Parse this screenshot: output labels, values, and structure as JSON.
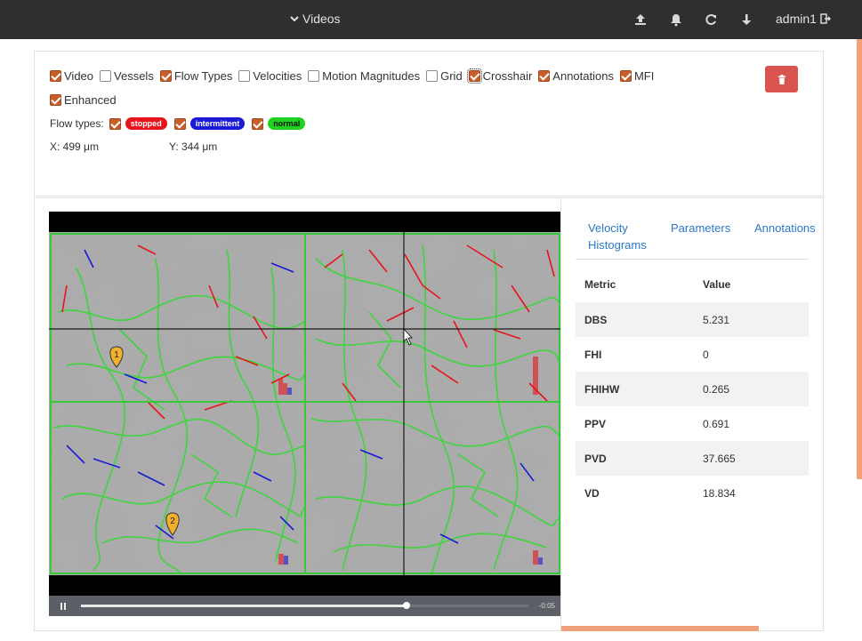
{
  "navbar": {
    "menu_label": "Videos",
    "user": "admin1"
  },
  "filters": {
    "checkboxes": [
      {
        "label": "Video",
        "checked": true
      },
      {
        "label": "Vessels",
        "checked": false
      },
      {
        "label": "Flow Types",
        "checked": true
      },
      {
        "label": "Velocities",
        "checked": false
      },
      {
        "label": "Motion Magnitudes",
        "checked": false
      },
      {
        "label": "Grid",
        "checked": false
      },
      {
        "label": "Crosshair",
        "checked": true
      },
      {
        "label": "Annotations",
        "checked": true
      },
      {
        "label": "MFI",
        "checked": true
      },
      {
        "label": "Enhanced",
        "checked": true
      }
    ],
    "flow_types_label": "Flow types:",
    "flow_types": [
      {
        "label": "stopped",
        "color": "#e8141c",
        "checked": true
      },
      {
        "label": "intermittent",
        "color": "#1a1ad6",
        "checked": true
      },
      {
        "label": "normal",
        "color": "#1fd21f",
        "checked": true
      }
    ],
    "x_coord": "X: 499 μm",
    "y_coord": "Y: 344 μm"
  },
  "video": {
    "time_remaining": "-0:05",
    "progress": 0.727,
    "markers": [
      "1",
      "2"
    ]
  },
  "tabs": [
    {
      "label": "Velocity Histograms"
    },
    {
      "label": "Parameters"
    },
    {
      "label": "Annotations"
    }
  ],
  "metrics": {
    "headers": [
      "Metric",
      "Value"
    ],
    "rows": [
      {
        "metric": "DBS",
        "value": "5.231"
      },
      {
        "metric": "FHI",
        "value": "0"
      },
      {
        "metric": "FHIHW",
        "value": "0.265"
      },
      {
        "metric": "PPV",
        "value": "0.691"
      },
      {
        "metric": "PVD",
        "value": "37.665"
      },
      {
        "metric": "VD",
        "value": "18.834"
      }
    ]
  },
  "colors": {
    "navbar": "#2e2f31",
    "checkbox_checked": "#c85e2c",
    "delete_button": "#d9534f",
    "link": "#2b78c5",
    "accent_orange": "#f0a07a"
  }
}
